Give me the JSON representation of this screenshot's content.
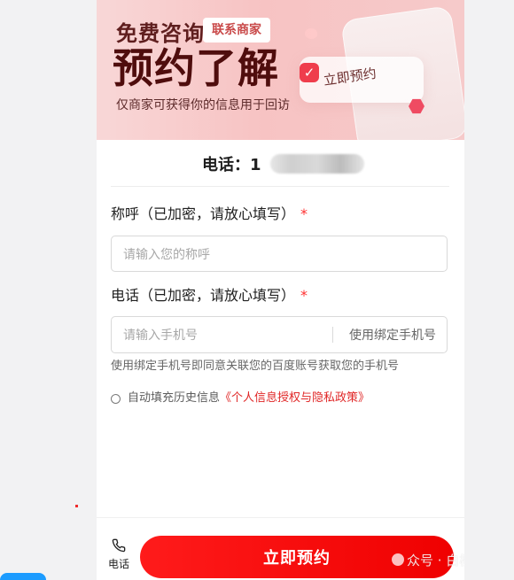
{
  "banner": {
    "free_title": "免费咨询",
    "badge": "联系商家",
    "main_title": "预约了解",
    "subtitle": "仅商家可获得你的信息用于回访",
    "appointment_chip": "立即预约",
    "phone_mockup": "phone-mockup"
  },
  "contact": {
    "header_prefix": "电话：",
    "header_visible_suffix": "1"
  },
  "form": {
    "name_label": "称呼（已加密，请放心填写）",
    "name_placeholder": "请输入您的称呼",
    "phone_label": "电话（已加密，请放心填写）",
    "phone_placeholder": "请输入手机号",
    "bind_phone_button": "使用绑定手机号",
    "bind_phone_helper": "使用绑定手机号即同意关联您的百度账号获取您的手机号",
    "required_mark": "*",
    "auto_fill_label": "自动填充历史信息",
    "privacy_link": "《个人信息授权与隐私政策》"
  },
  "bottom": {
    "call_label": "电话",
    "primary_button": "立即预约",
    "watermark": "众号 · 白杨SEO优化数品"
  },
  "icons": {
    "check": "check-icon",
    "hex": "hex-icon",
    "phone": "phone-icon",
    "radio": "radio-icon",
    "wechat": "wechat-icon"
  },
  "colors": {
    "accent": "#f00f0f",
    "link": "#e02727",
    "banner_bg": "#f7c3c3",
    "side_tab": "#1c9cff"
  }
}
